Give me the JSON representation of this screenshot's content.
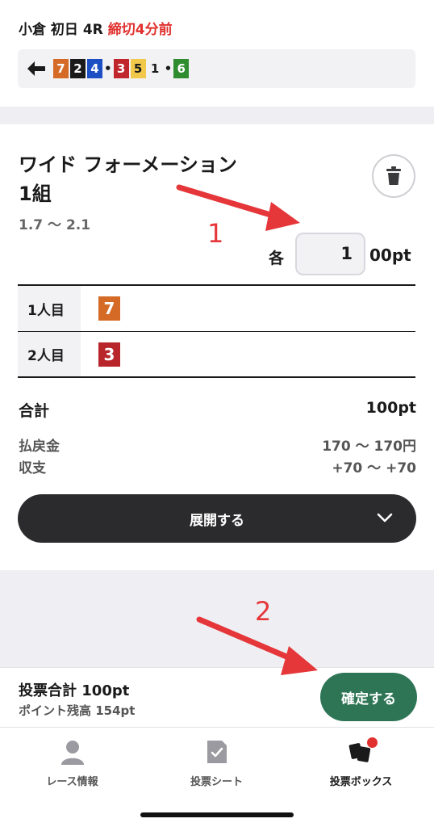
{
  "race": {
    "venue_info": "小倉 初日 4R",
    "deadline": "締切4分前",
    "picks": [
      {
        "n": "7",
        "bg": "#d46a26",
        "fg": "#ffffff"
      },
      {
        "n": "2",
        "bg": "#1a1a1a",
        "fg": "#ffffff"
      },
      {
        "n": "4",
        "bg": "#1d4fc4",
        "fg": "#ffffff"
      },
      {
        "sep": "•"
      },
      {
        "n": "3",
        "bg": "#c0272d",
        "fg": "#ffffff"
      },
      {
        "n": "5",
        "bg": "#f2c84b",
        "fg": "#1a1a1a"
      },
      {
        "n": "1",
        "bg": "#f2f2f4",
        "fg": "#1a1a1a"
      },
      {
        "sep": "•"
      },
      {
        "n": "6",
        "bg": "#2f8c2f",
        "fg": "#ffffff"
      }
    ]
  },
  "bet": {
    "type_line1": "ワイド フォーメーション",
    "type_line2": "1組",
    "odds": "1.7 ～ 2.1",
    "each_label": "各",
    "amount": "1",
    "unit": "00pt",
    "ranks": [
      {
        "label": "1人目",
        "num": "7",
        "color": "#d46a26"
      },
      {
        "label": "2人目",
        "num": "3",
        "color": "#b8262b"
      }
    ],
    "total_label": "合計",
    "total_value": "100pt",
    "payout_label": "払戻金",
    "payout_value": "170 ～ 170円",
    "balance_label": "収支",
    "balance_value": "+70 ～ +70",
    "expand_label": "展開する"
  },
  "footer": {
    "vote_total": "投票合計 100pt",
    "points_balance": "ポイント残高 154pt",
    "confirm_label": "確定する"
  },
  "tabs": [
    {
      "label": "レース情報"
    },
    {
      "label": "投票シート"
    },
    {
      "label": "投票ボックス"
    }
  ],
  "annotations": {
    "one": "1",
    "two": "2"
  },
  "colors": {
    "accent_red": "#e0312e",
    "confirm_green": "#2e7556",
    "dark_button": "#2b2b2d"
  }
}
